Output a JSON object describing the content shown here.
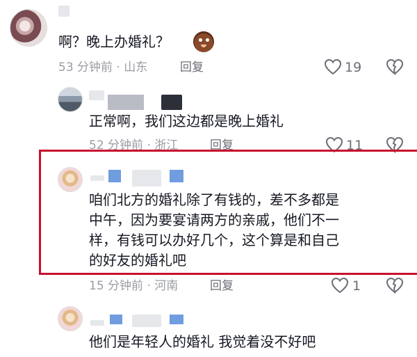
{
  "comments": [
    {
      "text": "啊？晚上办婚礼？",
      "meta": "53 分钟前 · 山东",
      "reply": "回复",
      "likes": "19"
    },
    {
      "text": "正常啊，我们这边都是晚上婚礼",
      "meta": "52 分钟前 · 浙江",
      "reply": "回复",
      "likes": "11"
    },
    {
      "text_lines": [
        "咱们北方的婚礼除了有钱的，差不多都是",
        "中午，因为要宴请两方的亲戚，他们不一",
        "样，有钱可以办好几个，这个算是和自己",
        "的好友的婚礼吧"
      ],
      "meta": "15 分钟前 · 河南",
      "reply": "回复",
      "likes": "1"
    },
    {
      "text": "他们是年轻人的婚礼 我觉着没不好吧"
    }
  ],
  "icons": {
    "like": "heart-outline-icon",
    "dislike": "broken-heart-icon",
    "emoji": "surprised-face-emoji-icon"
  },
  "colors": {
    "highlight_border": "#c8102e",
    "meta_gray": "#9a9ca3"
  }
}
